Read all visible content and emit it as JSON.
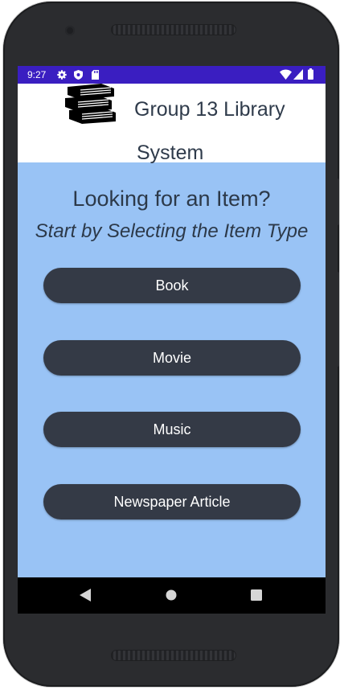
{
  "status_bar": {
    "time": "9:27",
    "icons": [
      "gear-icon",
      "shield-icon",
      "sd-card-icon",
      "wifi-icon",
      "signal-icon",
      "battery-icon"
    ],
    "color": "#3a1ec1"
  },
  "header": {
    "title_line1": "Group 13 Library",
    "title_line2": "System",
    "logo_icon": "books-stack-icon"
  },
  "main": {
    "heading": "Looking for an Item?",
    "subheading": "Start by Selecting the Item Type",
    "background": "#99c3f5",
    "buttons": [
      {
        "label": "Book"
      },
      {
        "label": "Movie"
      },
      {
        "label": "Music"
      },
      {
        "label": "Newspaper Article"
      }
    ],
    "button_color": "#343a46"
  },
  "nav_bar": {
    "icons": [
      "back-icon",
      "home-icon",
      "recents-icon"
    ]
  }
}
